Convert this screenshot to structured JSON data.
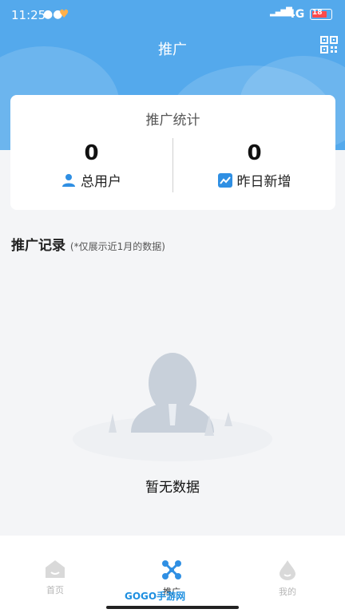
{
  "status_bar": {
    "time": "11:25",
    "network": "4G",
    "battery": "18"
  },
  "header": {
    "title": "推广"
  },
  "stats": {
    "title": "推广统计",
    "total_users": {
      "value": "0",
      "label": "总用户"
    },
    "new_yesterday": {
      "value": "0",
      "label": "昨日新增"
    }
  },
  "records": {
    "title": "推广记录",
    "note": "(*仅展示近1月的数据)"
  },
  "empty": {
    "text": "暂无数据"
  },
  "tabbar": {
    "items": [
      {
        "label": "首页",
        "icon": "home-icon"
      },
      {
        "label": "推广",
        "icon": "promotion-icon",
        "active": true
      },
      {
        "label": "我的",
        "icon": "profile-icon"
      }
    ]
  },
  "watermark": {
    "text": "GOGO手游网"
  },
  "colors": {
    "header": "#54a9ec",
    "accent": "#2f8fe3"
  }
}
